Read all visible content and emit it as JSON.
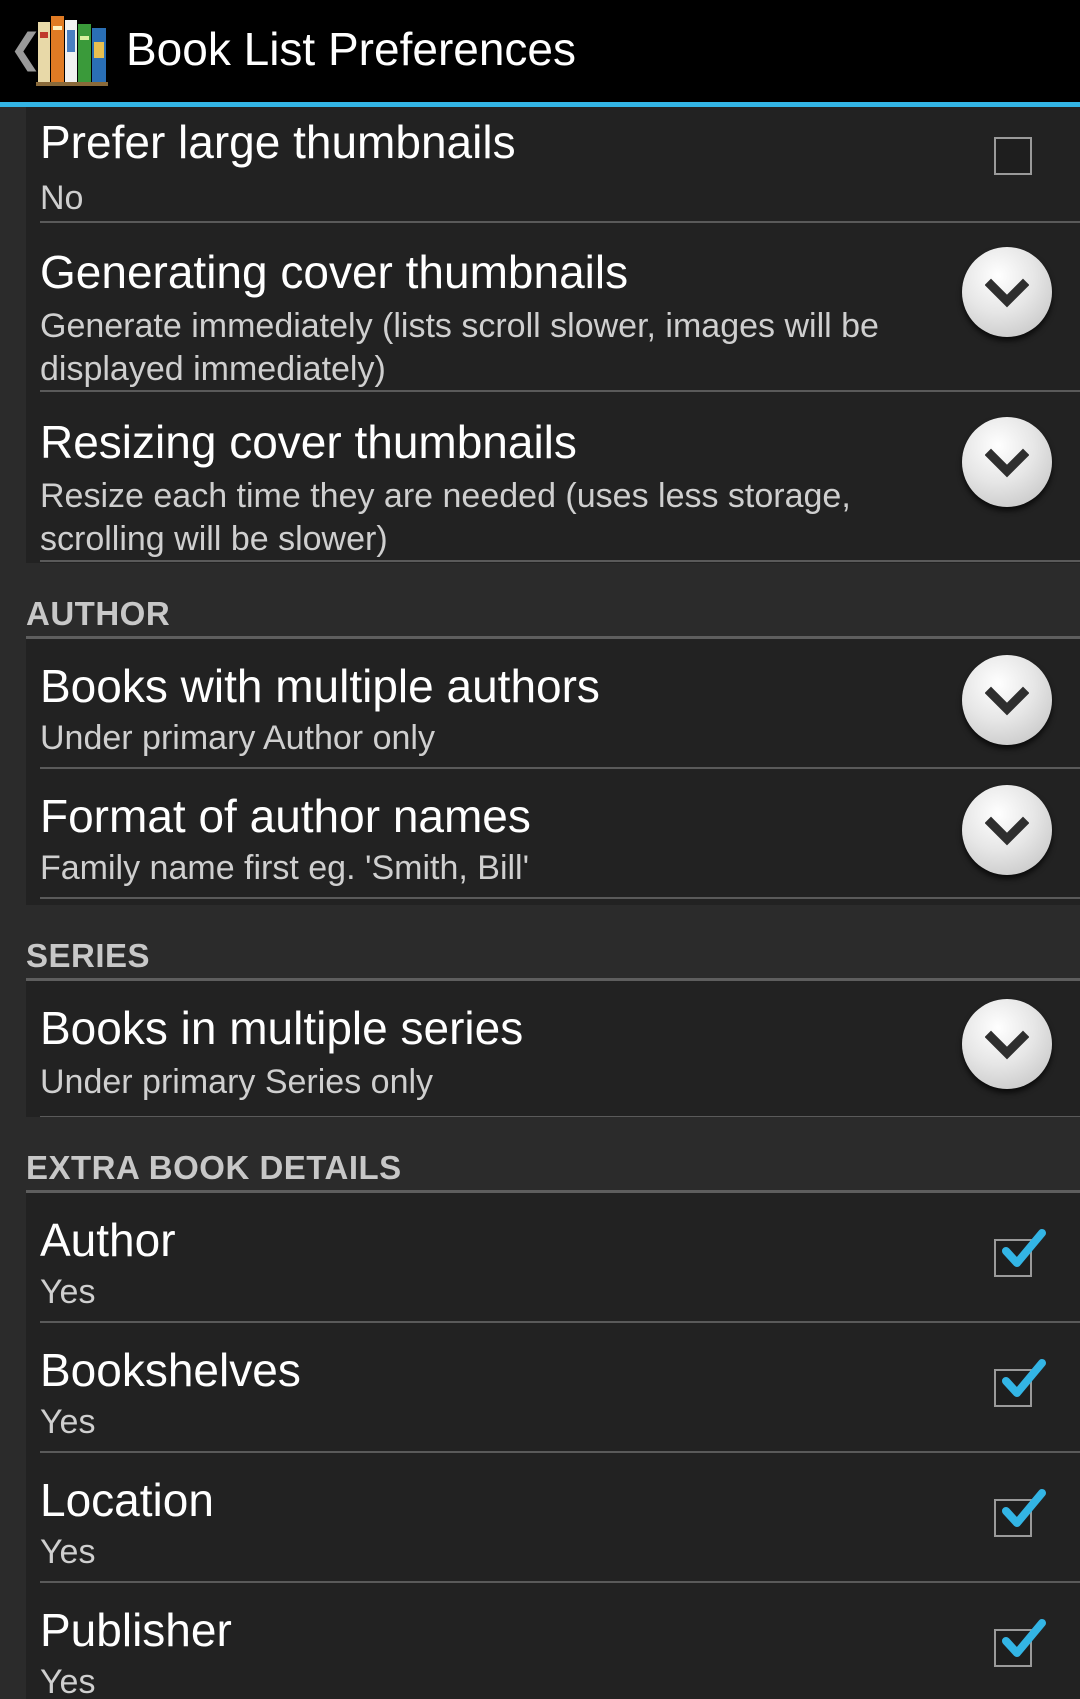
{
  "actionbar": {
    "title": "Book List Preferences",
    "back_glyph": "❮",
    "accent_color": "#33b5e5",
    "app_icon": "bookshelf-icon"
  },
  "thumbnails": {
    "prefer_large": {
      "title": "Prefer large thumbnails",
      "summary": "No",
      "checked": false
    },
    "generating": {
      "title": "Generating cover thumbnails",
      "summary": "Generate immediately (lists scroll slower, images will be displayed immediately)"
    },
    "resizing": {
      "title": "Resizing cover thumbnails",
      "summary": "Resize each time they are needed (uses less storage, scrolling will be slower)"
    }
  },
  "sections": {
    "author": "AUTHOR",
    "series": "SERIES",
    "extra": "EXTRA BOOK DETAILS"
  },
  "author": {
    "multiple_authors": {
      "title": "Books with multiple authors",
      "summary": "Under primary Author only"
    },
    "name_format": {
      "title": "Format of author names",
      "summary": "Family name first eg. 'Smith, Bill'"
    }
  },
  "series": {
    "multiple_series": {
      "title": "Books in multiple series",
      "summary": "Under primary Series only"
    }
  },
  "extra": {
    "author": {
      "title": "Author",
      "summary": "Yes",
      "checked": true
    },
    "bookshelves": {
      "title": "Bookshelves",
      "summary": "Yes",
      "checked": true
    },
    "location": {
      "title": "Location",
      "summary": "Yes",
      "checked": true
    },
    "publisher": {
      "title": "Publisher",
      "summary": "Yes",
      "checked": true
    }
  }
}
